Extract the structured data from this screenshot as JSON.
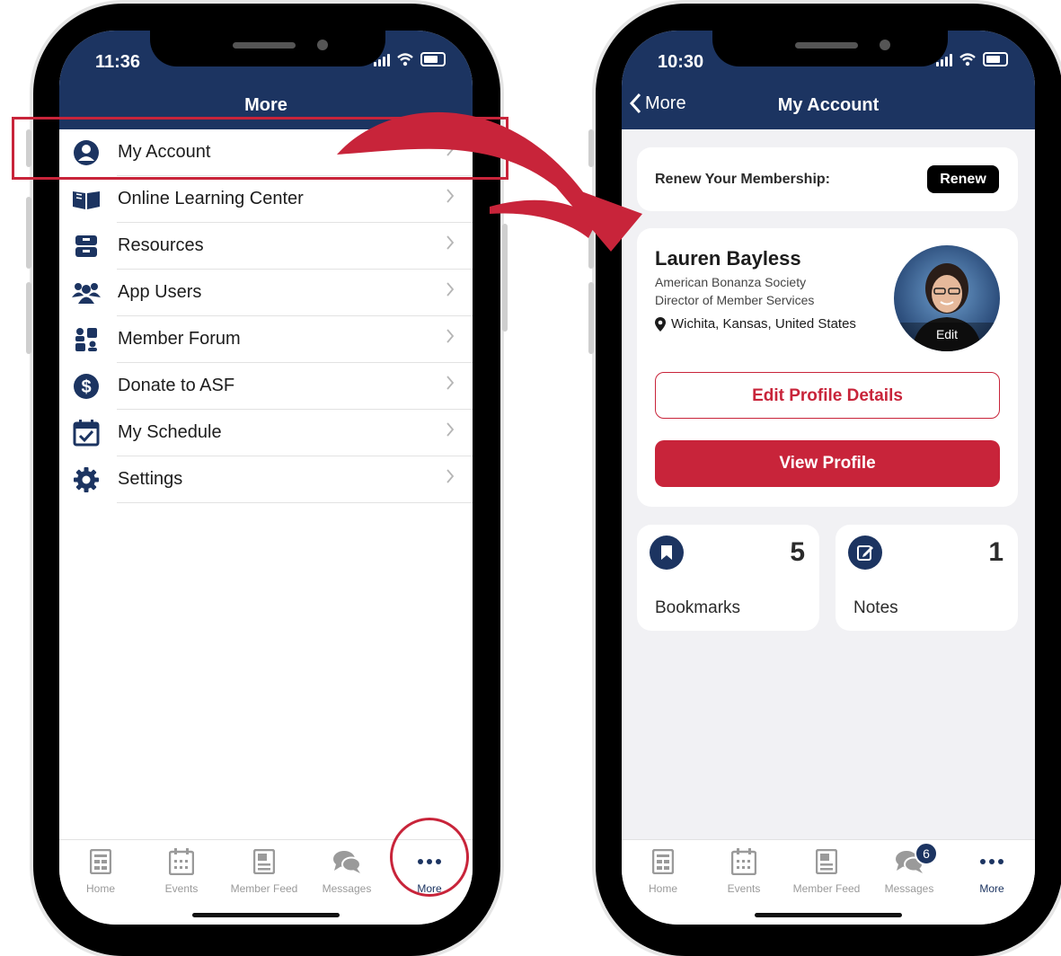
{
  "left": {
    "status_time": "11:36",
    "header_title": "More",
    "menu": [
      {
        "label": "My Account",
        "icon": "user-circle-icon"
      },
      {
        "label": "Online Learning Center",
        "icon": "open-book-icon"
      },
      {
        "label": "Resources",
        "icon": "archive-box-icon"
      },
      {
        "label": "App Users",
        "icon": "users-icon"
      },
      {
        "label": "Member Forum",
        "icon": "forum-icon"
      },
      {
        "label": "Donate to ASF",
        "icon": "dollar-icon"
      },
      {
        "label": "My Schedule",
        "icon": "calendar-check-icon"
      },
      {
        "label": "Settings",
        "icon": "gear-icon"
      }
    ],
    "tabs": [
      {
        "label": "Home",
        "icon": "home-grid-icon"
      },
      {
        "label": "Events",
        "icon": "calendar-icon"
      },
      {
        "label": "Member Feed",
        "icon": "news-icon"
      },
      {
        "label": "Messages",
        "icon": "chat-icon"
      },
      {
        "label": "More",
        "icon": "more-dots-icon"
      }
    ]
  },
  "right": {
    "status_time": "10:30",
    "back_label": "More",
    "header_title": "My Account",
    "renew": {
      "label": "Renew Your Membership:",
      "button": "Renew"
    },
    "profile": {
      "name": "Lauren Bayless",
      "organization": "American Bonanza Society",
      "title": "Director of Member Services",
      "location": "Wichita, Kansas, United States",
      "avatar_edit": "Edit",
      "edit_button": "Edit Profile Details",
      "view_button": "View Profile"
    },
    "stats": [
      {
        "label": "Bookmarks",
        "count": "5",
        "icon": "bookmark-icon"
      },
      {
        "label": "Notes",
        "count": "1",
        "icon": "edit-note-icon"
      }
    ],
    "tabs": [
      {
        "label": "Home",
        "icon": "home-grid-icon"
      },
      {
        "label": "Events",
        "icon": "calendar-icon"
      },
      {
        "label": "Member Feed",
        "icon": "news-icon"
      },
      {
        "label": "Messages",
        "icon": "chat-icon",
        "badge": "6"
      },
      {
        "label": "More",
        "icon": "more-dots-icon"
      }
    ]
  },
  "colors": {
    "navy": "#1c3461",
    "accent_red": "#c8243a",
    "tab_gray": "#9a9a9a"
  }
}
